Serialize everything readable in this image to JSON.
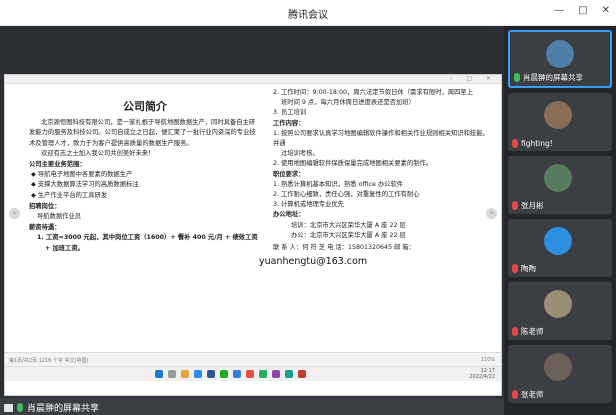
{
  "window": {
    "title": "腾讯会议",
    "min_label": "—",
    "max_label": "□",
    "close_label": "✕"
  },
  "document": {
    "left": {
      "heading": "公司简介",
      "intro1": "北京源恒图科技有限公司，是一家扎根于导航地图数据生产，同时具备自主研发能力的服务及科技公司。公司自成立之日起，便汇聚了一批行业内资深的专业技术及管理人才，致力于为客户提供高质量的数据生产服务。",
      "intro2": "欢迎有志之士加入我公司共创美好未来！",
      "biz_title": "公司主要业务范围：",
      "biz": [
        "◆ 导航电子地图中各要素的数据生产",
        "◆ 支撑大数据算法学习的高质数据标注",
        "◆ 生产作业平台的工具研发"
      ],
      "job_title": "招聘岗位：",
      "job": "导航数据作业员",
      "salary_title": "薪资待遇：",
      "salary1": "1. 工资=3000 元起，其中岗位工资（1600）+ 餐补 400 元/月 + 绩效工资",
      "salary1b": "+ 加班工资。"
    },
    "right": {
      "lines_top": [
        "2. 工作时间：9:00-18:00，周六法定节假日休（需求有限时，周四至上",
        "班时间 9 点，每六月休周日进度表还是否加班）",
        "3. 员工培训"
      ],
      "content_title": "工作内容：",
      "content": [
        "1. 按照公司要求认真学习地图编辑软件操作和相关作业规则相关知识和技能。并通",
        "过培训考核。",
        "2. 使用地图编辑软件保质保量完成地图相关要素的制作。"
      ],
      "req_title": "职位要求：",
      "req": [
        "1. 熟悉计算机基本知识，熟悉 office 办公软件",
        "2. 工作耐心细致，责任心强，对重复性的工作有耐心",
        "3. 计算机或地理专业优先"
      ],
      "addr_title": "办公地址：",
      "addr": [
        "培训：北京市大兴区荣华大厦 A 座 22 层",
        "办公：北京市大兴区荣华大厦 A 座 22 层"
      ],
      "contact": "联 系 人：何 符 芝     电 话：15801320645     邮 箱：",
      "email": "yuanhengtu@163.com"
    },
    "status_left": "第1页/共2页   1216 个字   中文(中国)",
    "status_right": "110%"
  },
  "taskbar": {
    "time": "12:17",
    "date": "2022/4/22"
  },
  "share_bar": {
    "label": "肖晨翀的屏幕共享"
  },
  "participants": [
    {
      "name": "肖晨翀的屏幕共享",
      "avatar_color": "#4f7fa8",
      "mic": "on"
    },
    {
      "name": "fighting!",
      "avatar_color": "#8a6d57",
      "mic": "off"
    },
    {
      "name": "张月彬",
      "avatar_color": "#5a7c5e",
      "mic": "off"
    },
    {
      "name": "陶陶",
      "avatar_color": "#2e8fe0",
      "mic": "off"
    },
    {
      "name": "陈老师",
      "avatar_color": "#9a8e74",
      "mic": "off"
    },
    {
      "name": "张老师",
      "avatar_color": "#6d5f5a",
      "mic": "off"
    }
  ],
  "colors": {
    "accent": "#3aa0ff",
    "mic_on": "#3cc05c",
    "mic_off": "#e24a4a"
  }
}
